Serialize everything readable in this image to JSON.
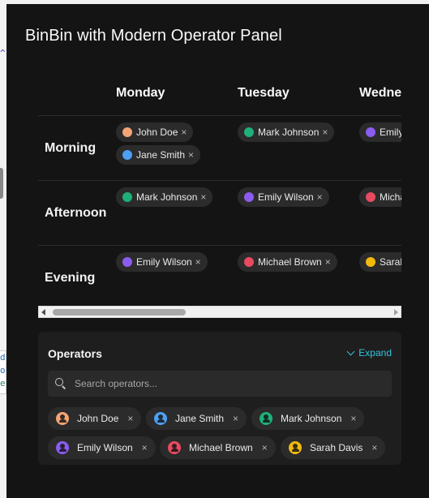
{
  "title": "BinBin with Modern Operator Panel",
  "days": [
    "Monday",
    "Tuesday",
    "Wednesday"
  ],
  "slots": [
    "Morning",
    "Afternoon",
    "Evening"
  ],
  "remove_symbol": "×",
  "schedule": {
    "morning": {
      "monday": [
        {
          "name": "John Doe",
          "color": "#f4a474"
        },
        {
          "name": "Jane Smith",
          "color": "#4d9ff2"
        }
      ],
      "tuesday": [
        {
          "name": "Mark Johnson",
          "color": "#1fb07a"
        }
      ],
      "wednesday": [
        {
          "name": "Emily Wilson",
          "color": "#8b5cf0"
        }
      ]
    },
    "afternoon": {
      "monday": [
        {
          "name": "Mark Johnson",
          "color": "#1fb07a"
        }
      ],
      "tuesday": [
        {
          "name": "Emily Wilson",
          "color": "#8b5cf0"
        }
      ],
      "wednesday": [
        {
          "name": "Michael Brown",
          "color": "#e84a5f"
        }
      ]
    },
    "evening": {
      "monday": [
        {
          "name": "Emily Wilson",
          "color": "#8b5cf0"
        }
      ],
      "tuesday": [
        {
          "name": "Michael Brown",
          "color": "#e84a5f"
        }
      ],
      "wednesday": [
        {
          "name": "Sarah Davis",
          "color": "#f2b90c"
        }
      ]
    }
  },
  "operators_panel": {
    "title": "Operators",
    "expand_label": "Expand",
    "search_placeholder": "Search operators...",
    "operators": [
      {
        "name": "John Doe",
        "color": "#f4a474"
      },
      {
        "name": "Jane Smith",
        "color": "#4d9ff2"
      },
      {
        "name": "Mark Johnson",
        "color": "#1fb07a"
      },
      {
        "name": "Emily Wilson",
        "color": "#8b5cf0"
      },
      {
        "name": "Michael Brown",
        "color": "#e84a5f"
      },
      {
        "name": "Sarah Davis",
        "color": "#f2b90c"
      }
    ]
  }
}
